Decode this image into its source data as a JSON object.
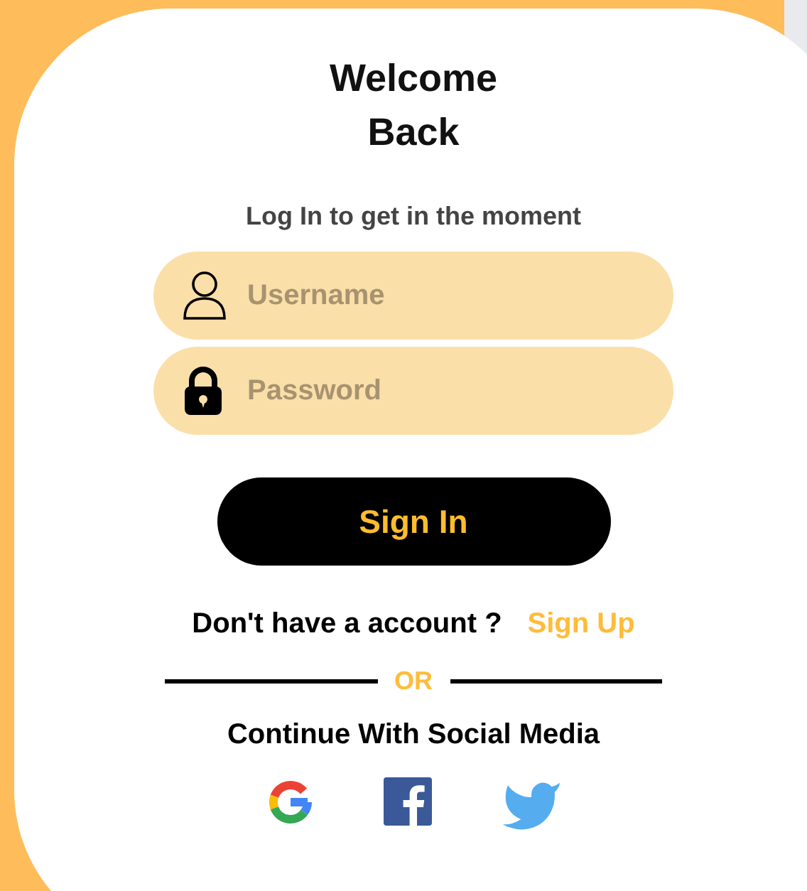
{
  "title": "Welcome Back",
  "subtitle": "Log In to get in the moment",
  "fields": [
    {
      "kind": "username",
      "placeholder": "Username"
    },
    {
      "kind": "password",
      "placeholder": "Password"
    }
  ],
  "sign_in_button": "Sign In",
  "signup_prompt": {
    "text": "Don't have a account ?",
    "link": "Sign Up"
  },
  "divider_label": "OR",
  "social_heading": "Continue With Social Media",
  "social_links": [
    {
      "kind": "google"
    },
    {
      "kind": "facebook"
    },
    {
      "kind": "twitter"
    }
  ]
}
